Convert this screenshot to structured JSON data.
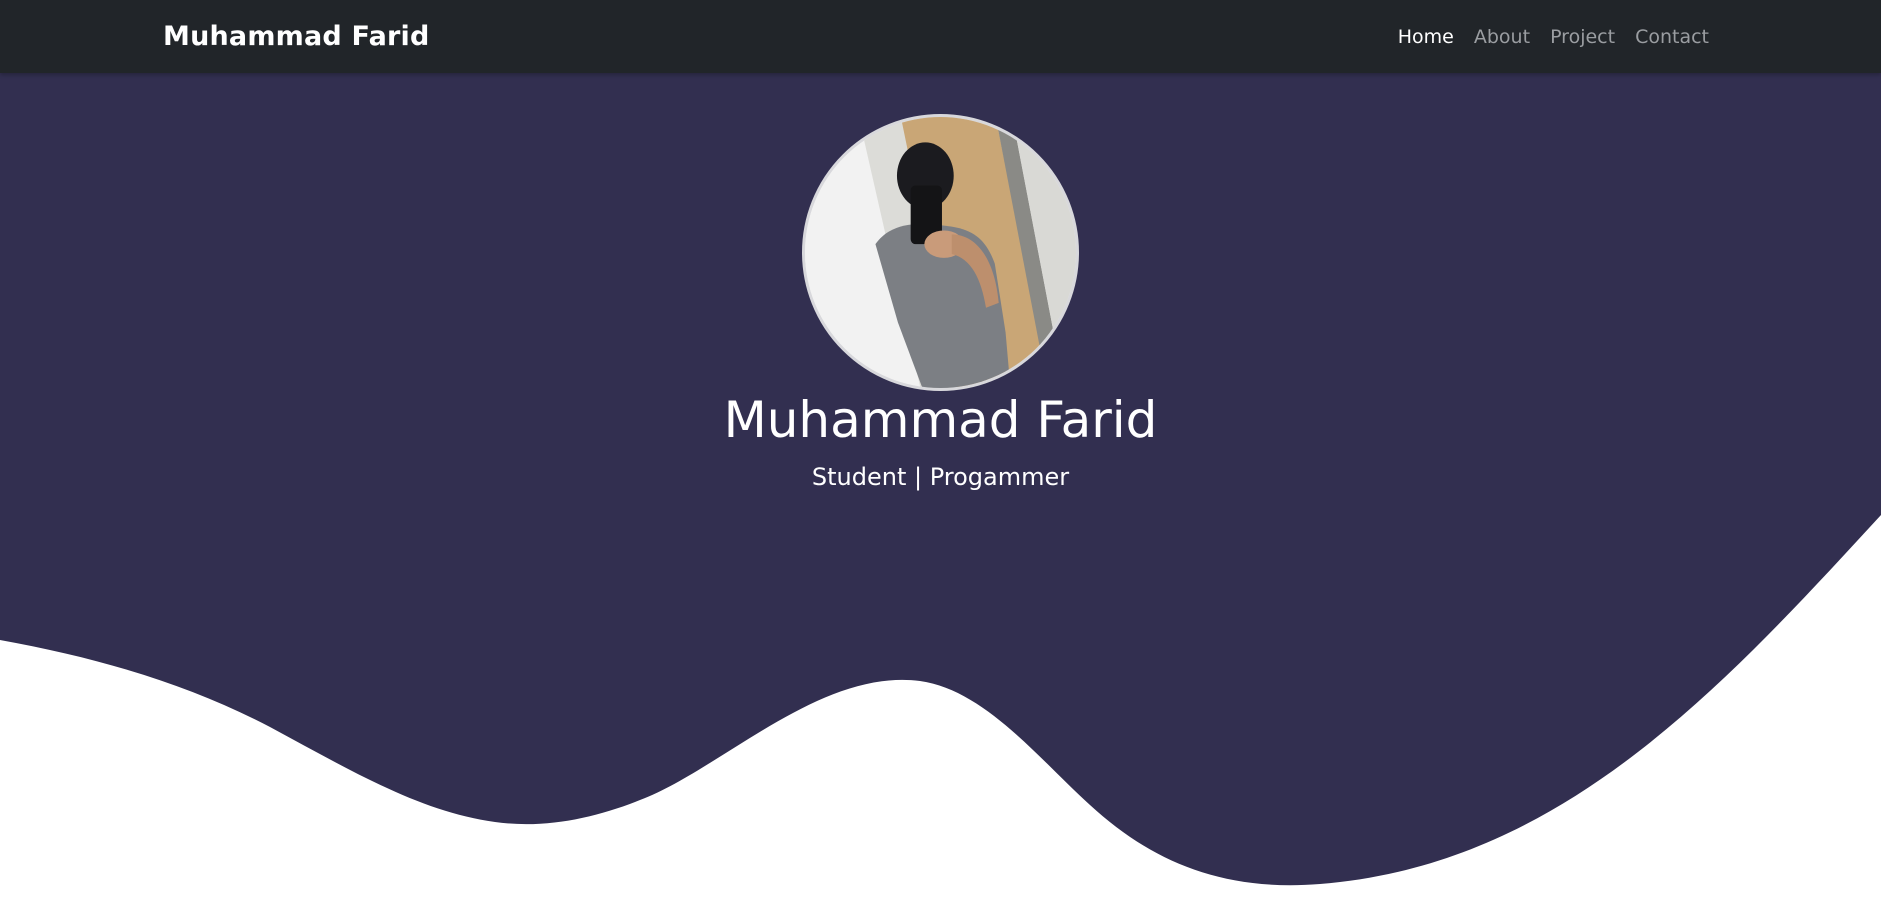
{
  "navbar": {
    "brand": "Muhammad Farid",
    "links": [
      {
        "label": "Home",
        "active": true
      },
      {
        "label": "About",
        "active": false
      },
      {
        "label": "Project",
        "active": false
      },
      {
        "label": "Contact",
        "active": false
      }
    ]
  },
  "hero": {
    "name": "Muhammad Farid",
    "role": "Student | Progammer"
  },
  "colors": {
    "navbar_bg": "#212529",
    "hero_bg": "#322f50",
    "page_bg": "#ffffff",
    "nav_link": "#9a9da1",
    "nav_link_active": "#ffffff"
  }
}
